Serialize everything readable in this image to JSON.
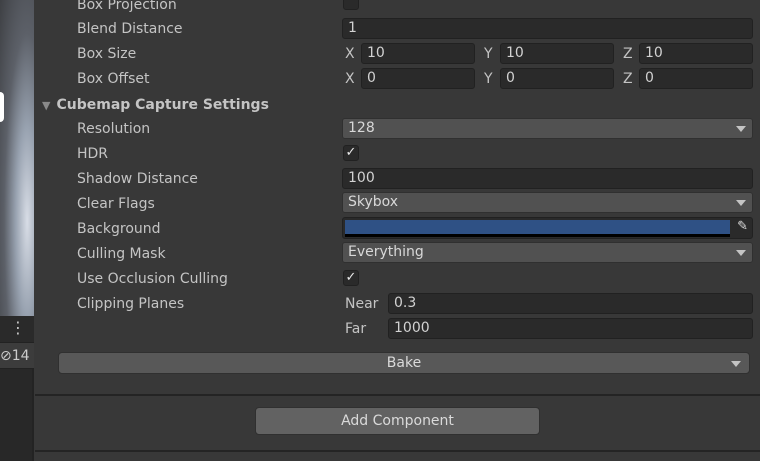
{
  "left_panel": {
    "menu_icon": "vertical-ellipsis-icon",
    "count_icon": "eye-slash-icon",
    "count": "14"
  },
  "rows": {
    "box_projection": {
      "label": "Box Projection",
      "checked": false
    },
    "blend_distance": {
      "label": "Blend Distance",
      "value": "1"
    },
    "box_size": {
      "label": "Box Size",
      "x": "10",
      "y": "10",
      "z": "10"
    },
    "box_offset": {
      "label": "Box Offset",
      "x": "0",
      "y": "0",
      "z": "0"
    },
    "axes": {
      "x": "X",
      "y": "Y",
      "z": "Z"
    }
  },
  "cubemap": {
    "header": "Cubemap Capture Settings",
    "resolution": {
      "label": "Resolution",
      "value": "128"
    },
    "hdr": {
      "label": "HDR",
      "checked": true
    },
    "shadow_distance": {
      "label": "Shadow Distance",
      "value": "100"
    },
    "clear_flags": {
      "label": "Clear Flags",
      "value": "Skybox"
    },
    "background": {
      "label": "Background",
      "color": "#2f5185"
    },
    "culling_mask": {
      "label": "Culling Mask",
      "value": "Everything"
    },
    "occlusion": {
      "label": "Use Occlusion Culling",
      "checked": true
    },
    "clipping": {
      "label": "Clipping Planes",
      "near_label": "Near",
      "near": "0.3",
      "far_label": "Far",
      "far": "1000"
    }
  },
  "bake_label": "Bake",
  "add_component_label": "Add Component",
  "check_mark": "✓"
}
